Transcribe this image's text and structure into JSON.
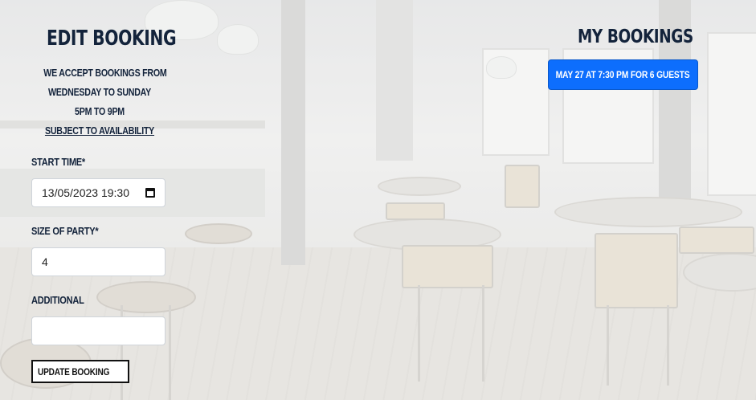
{
  "edit": {
    "title": "Edit Booking",
    "info_line1": "We accept bookings from",
    "info_line2": "Wednesday to Sunday",
    "info_line3": "5pm to 9pm",
    "info_link": "Subject to availability"
  },
  "form": {
    "start_time_label": "Start Time*",
    "start_time_value": "13/05/2023 19:30",
    "party_size_label": "Size of Party*",
    "party_size_value": "4",
    "additional_label": "Additional",
    "additional_value": "",
    "submit_label": "Update Booking"
  },
  "my_bookings": {
    "title": "My Bookings",
    "items": [
      {
        "label": "May 27 at 7:30 pm for 6 guests"
      }
    ],
    "chip_color": "#0d6efd"
  },
  "icons": {
    "calendar": "calendar-icon"
  }
}
